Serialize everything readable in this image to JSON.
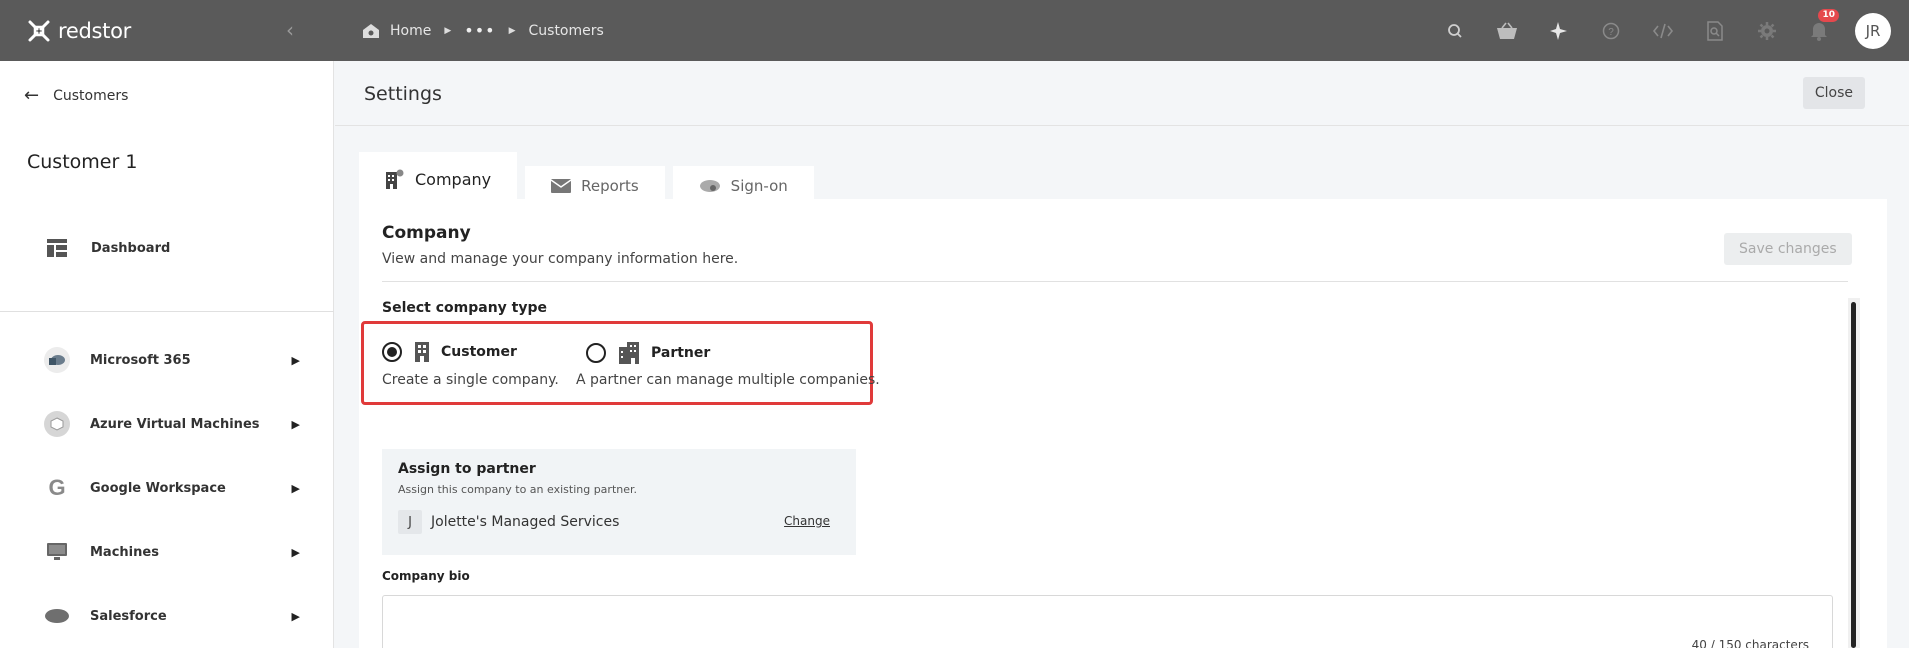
{
  "topbar": {
    "brand": "redstor",
    "breadcrumb": {
      "home": "Home",
      "ellipsis": "•••",
      "current": "Customers"
    },
    "notification_count": "10",
    "user_initials": "JR",
    "colors": {
      "bar": "#5a5a5a",
      "badge": "#e5484d"
    }
  },
  "sidebar": {
    "back_label": "Customers",
    "customer_name": "Customer 1",
    "dashboard_label": "Dashboard",
    "items": [
      {
        "label": "Microsoft 365",
        "icon": "microsoft-365-icon"
      },
      {
        "label": "Azure Virtual Machines",
        "icon": "azure-vm-icon"
      },
      {
        "label": "Google Workspace",
        "icon": "google-icon"
      },
      {
        "label": "Machines",
        "icon": "monitor-icon"
      },
      {
        "label": "Salesforce",
        "icon": "salesforce-icon"
      }
    ]
  },
  "main": {
    "title": "Settings",
    "close_label": "Close",
    "tabs": [
      {
        "label": "Company",
        "active": true
      },
      {
        "label": "Reports",
        "active": false
      },
      {
        "label": "Sign-on",
        "active": false
      }
    ],
    "company": {
      "heading": "Company",
      "subheading": "View and manage your company information here.",
      "save_label": "Save changes",
      "type_label": "Select company type",
      "options": [
        {
          "label": "Customer",
          "desc": "Create a single company.",
          "selected": true
        },
        {
          "label": "Partner",
          "desc": "A partner can manage multiple companies.",
          "selected": false
        }
      ],
      "assign": {
        "title": "Assign to partner",
        "subtitle": "Assign this company to an existing partner.",
        "partner_initial": "J",
        "partner_name": "Jolette's Managed Services",
        "change_label": "Change"
      },
      "bio": {
        "label": "Company bio",
        "char_count": "40 / 150 characters"
      },
      "highlight_color": "#e03a3a"
    }
  }
}
